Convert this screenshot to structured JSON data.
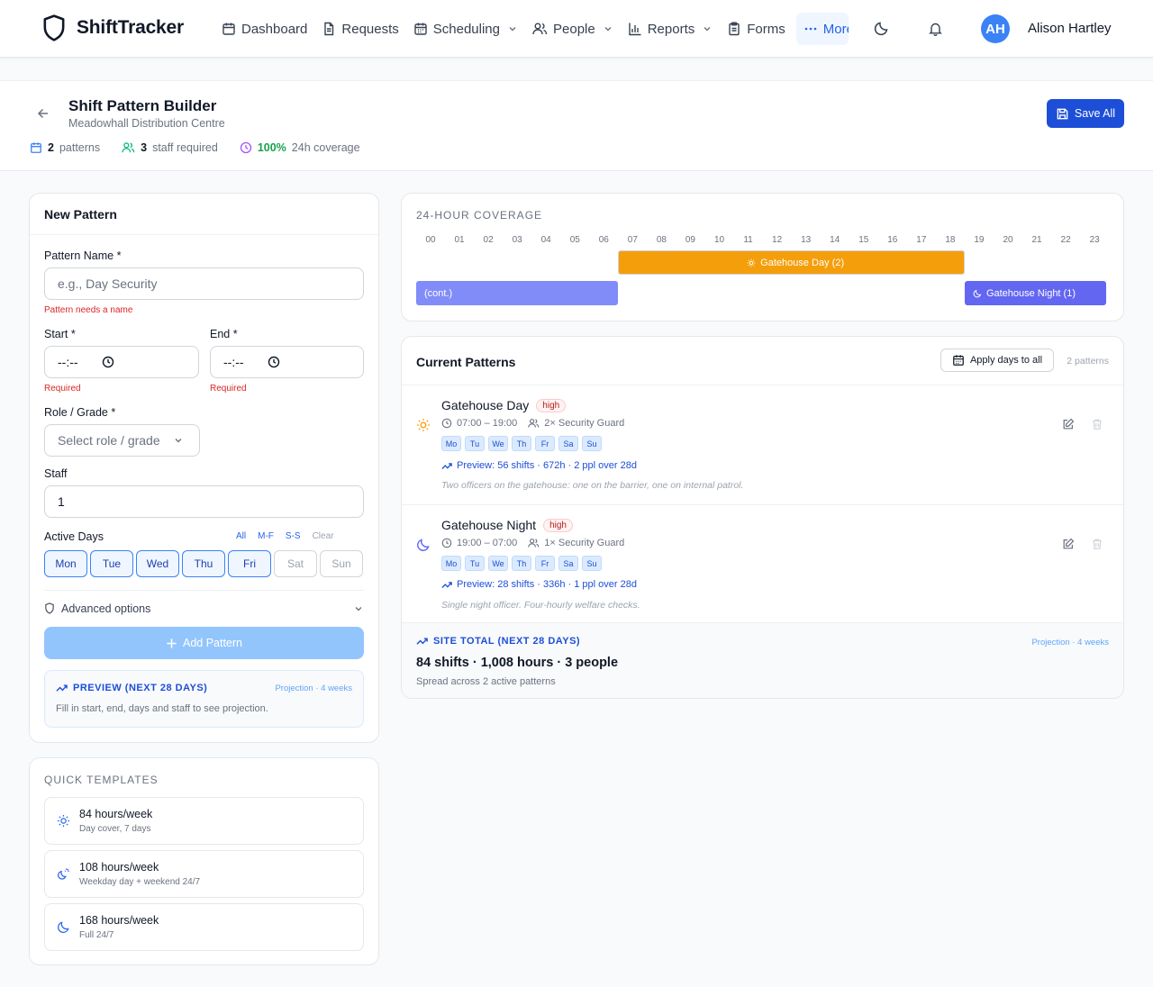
{
  "app": {
    "brand": "ShiftTracker",
    "nav": [
      {
        "label": "Dashboard",
        "icon": "calendar-icon",
        "dropdown": false
      },
      {
        "label": "Requests",
        "icon": "document-icon",
        "dropdown": false
      },
      {
        "label": "Scheduling",
        "icon": "calendar-icon",
        "dropdown": true
      },
      {
        "label": "People",
        "icon": "users-icon",
        "dropdown": true
      },
      {
        "label": "Reports",
        "icon": "bar-chart-icon",
        "dropdown": true
      },
      {
        "label": "Forms",
        "icon": "clipboard-icon",
        "dropdown": false
      }
    ],
    "more_label": "More",
    "user": {
      "initials": "AH",
      "name": "Alison Hartley"
    }
  },
  "header": {
    "title": "Shift Pattern Builder",
    "subtitle": "Meadowhall Distribution Centre",
    "stats": {
      "patterns_value": "2",
      "patterns_label": "patterns",
      "staff_value": "3",
      "staff_label": "staff required",
      "coverage_value": "100%",
      "coverage_label": "24h coverage"
    },
    "save_label": "Save All"
  },
  "form": {
    "title": "New Pattern",
    "name_label": "Pattern Name *",
    "name_placeholder": "e.g., Day Security",
    "name_error": "Pattern needs a name",
    "start_label": "Start *",
    "end_label": "End *",
    "time_placeholder": "--:--",
    "required_error": "Required",
    "role_label": "Role / Grade *",
    "role_placeholder": "Select role / grade",
    "staff_label": "Staff",
    "staff_value": "1",
    "days_label": "Active Days",
    "quick_days": [
      "All",
      "M-F",
      "S-S",
      "Clear"
    ],
    "days": [
      {
        "label": "Mon",
        "active": true
      },
      {
        "label": "Tue",
        "active": true
      },
      {
        "label": "Wed",
        "active": true
      },
      {
        "label": "Thu",
        "active": true
      },
      {
        "label": "Fri",
        "active": true
      },
      {
        "label": "Sat",
        "active": false
      },
      {
        "label": "Sun",
        "active": false
      }
    ],
    "advanced_label": "Advanced options",
    "add_label": "Add Pattern",
    "preview_title": "PREVIEW (NEXT 28 DAYS)",
    "preview_projection": "Projection · 4 weeks",
    "preview_desc": "Fill in start, end, days and staff to see projection."
  },
  "templates": {
    "title": "QUICK TEMPLATES",
    "items": [
      {
        "title": "84 hours/week",
        "subtitle": "Day cover, 7 days",
        "icon": "sun-icon"
      },
      {
        "title": "108 hours/week",
        "subtitle": "Weekday day + weekend 24/7",
        "icon": "sun-moon-icon"
      },
      {
        "title": "168 hours/week",
        "subtitle": "Full 24/7",
        "icon": "moon-icon"
      }
    ]
  },
  "coverage": {
    "title": "24-HOUR COVERAGE",
    "hours": [
      "00",
      "01",
      "02",
      "03",
      "04",
      "05",
      "06",
      "07",
      "08",
      "09",
      "10",
      "11",
      "12",
      "13",
      "14",
      "15",
      "16",
      "17",
      "18",
      "19",
      "20",
      "21",
      "22",
      "23"
    ],
    "bars": [
      {
        "label": "Gatehouse Day (2)",
        "kind": "day",
        "start": 7,
        "end": 19,
        "row": 0
      },
      {
        "label": "(cont.)",
        "kind": "cont",
        "start": 0,
        "end": 7,
        "row": 1
      },
      {
        "label": "Gatehouse Night (1)",
        "kind": "night",
        "start": 19,
        "end": 24,
        "row": 1
      }
    ]
  },
  "current": {
    "title": "Current Patterns",
    "apply_label": "Apply days to all",
    "count_label": "2 patterns",
    "patterns": [
      {
        "name": "Gatehouse Day",
        "priority": "high",
        "icon": "sun-icon",
        "time": "07:00 – 19:00",
        "staff": "2× Security Guard",
        "days": [
          "Mo",
          "Tu",
          "We",
          "Th",
          "Fr",
          "Sa",
          "Su"
        ],
        "preview": "Preview: 56 shifts · 672h · 2 ppl over 28d",
        "note": "Two officers on the gatehouse: one on the barrier, one on internal patrol."
      },
      {
        "name": "Gatehouse Night",
        "priority": "high",
        "icon": "moon-icon",
        "time": "19:00 – 07:00",
        "staff": "1× Security Guard",
        "days": [
          "Mo",
          "Tu",
          "We",
          "Th",
          "Fr",
          "Sa",
          "Su"
        ],
        "preview": "Preview: 28 shifts · 336h · 1 ppl over 28d",
        "note": "Single night officer. Four-hourly welfare checks."
      }
    ],
    "site_title": "SITE TOTAL (NEXT 28 DAYS)",
    "site_projection": "Projection · 4 weeks",
    "site_big": "84 shifts · 1,008 hours · 3 people",
    "site_sub": "Spread across 2 active patterns"
  },
  "colors": {
    "primary": "#1d4ed8",
    "day_bar": "#f59e0b",
    "night_bar": "#6366f1",
    "cont_bar": "#818cf8",
    "error": "#dc2626",
    "success": "#16a34a"
  }
}
